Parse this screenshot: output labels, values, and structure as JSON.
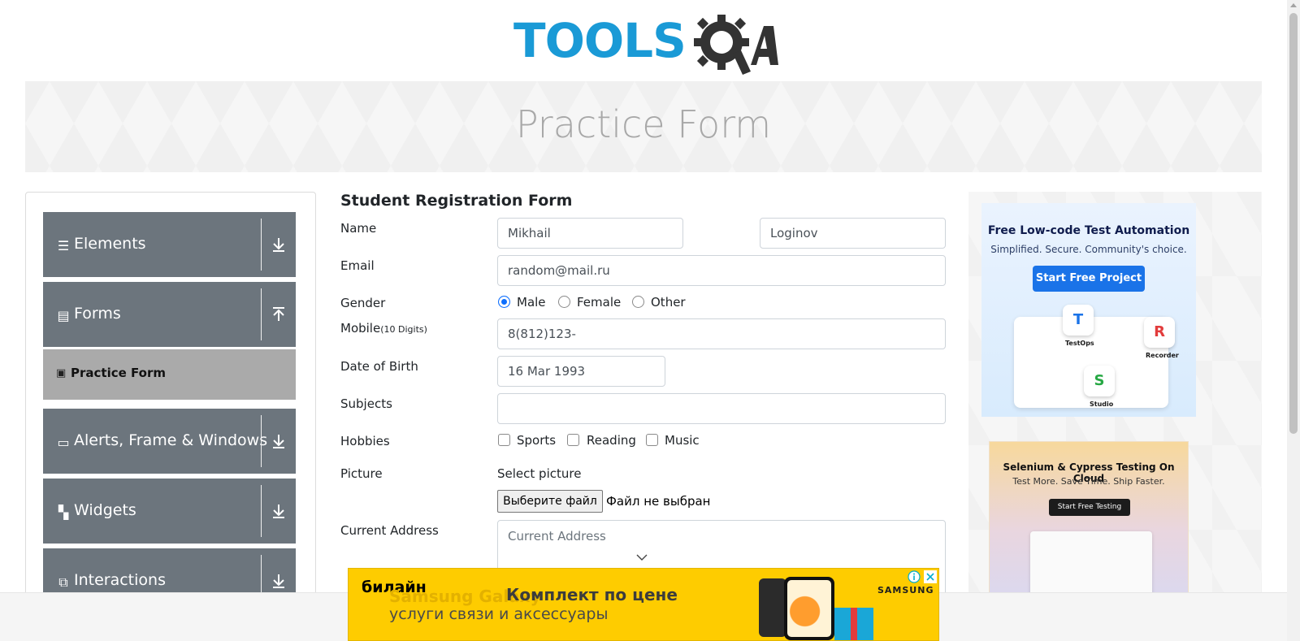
{
  "header": {
    "logo_text": "TOOLSQA"
  },
  "banner": {
    "title": "Practice Form"
  },
  "sidebar": {
    "groups": [
      {
        "label": "Elements",
        "icon": "list-icon",
        "arrow": "down"
      },
      {
        "label": "Forms",
        "icon": "document-icon",
        "arrow": "up"
      },
      {
        "label": "Alerts, Frame & Windows",
        "icon": "window-icon",
        "arrow": "down"
      },
      {
        "label": "Widgets",
        "icon": "widgets-icon",
        "arrow": "down"
      },
      {
        "label": "Interactions",
        "icon": "interactions-icon",
        "arrow": "down"
      }
    ],
    "active_item": {
      "label": "Practice Form",
      "icon": "form-icon"
    }
  },
  "form": {
    "title": "Student Registration Form",
    "name_label": "Name",
    "first_name": "Mikhail",
    "last_name": "Loginov",
    "email_label": "Email",
    "email": "random@mail.ru",
    "gender_label": "Gender",
    "genders": [
      "Male",
      "Female",
      "Other"
    ],
    "gender_selected": "Male",
    "mobile_label": "Mobile",
    "mobile_hint": "(10 Digits)",
    "mobile": "8(812)123-",
    "dob_label": "Date of Birth",
    "dob": "16 Mar 1993",
    "subjects_label": "Subjects",
    "subjects": "",
    "hobbies_label": "Hobbies",
    "hobbies": [
      "Sports",
      "Reading",
      "Music"
    ],
    "picture_label": "Picture",
    "picture_hint": "Select picture",
    "file_button": "Выберите файл",
    "file_status": "Файл не выбран",
    "address_label": "Current Address",
    "address_placeholder": "Current Address"
  },
  "ads": {
    "right_top": {
      "title": "Free Low-code Test Automation",
      "subtitle": "Simplified. Secure. Community's choice.",
      "button": "Start Free Project",
      "tiles": [
        "TestOps",
        "Recorder",
        "Studio"
      ]
    },
    "right_bottom": {
      "title": "Selenium & Cypress Testing On Cloud",
      "subtitle": "Test More. Save Time. Ship Faster.",
      "button": "Start Free Testing"
    },
    "bottom": {
      "brand": "билайн",
      "ghost": "Samsung Galaxy",
      "headline": "Комплект по цене",
      "subline": "услуги связи и аксессуары",
      "maker": "SAMSUNG"
    }
  },
  "colors": {
    "brand_blue": "#1a9ad6",
    "sidebar_header": "#6c757d",
    "sidebar_active": "#aaaaaa",
    "radio_checked": "#0d6efd",
    "ad_yellow": "#fecc00"
  }
}
